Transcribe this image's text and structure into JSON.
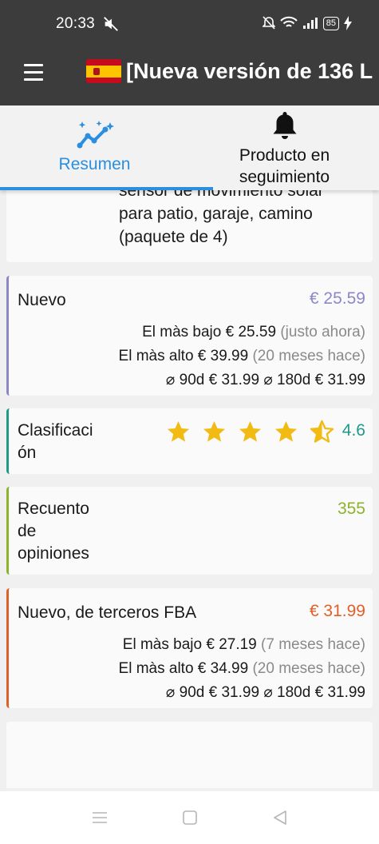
{
  "status_bar": {
    "time": "20:33",
    "battery": "85"
  },
  "app_bar": {
    "title": "[Nueva versión de 136 L",
    "flag": "spain-flag"
  },
  "tabs": [
    {
      "label": "Resumen",
      "icon": "sparkle-chart-icon",
      "active": true
    },
    {
      "label_line1": "Producto en",
      "label_line2": "seguimiento",
      "icon": "bell-icon",
      "active": false
    }
  ],
  "product": {
    "description_lines": [
      "sensor de movimiento solar",
      "para patio, garaje, camino",
      "(paquete de 4)"
    ]
  },
  "new_price": {
    "title": "Nuevo",
    "price": "€ 25.59",
    "lowest_label": "El màs bajo",
    "lowest_price": "€ 25.59",
    "lowest_when": "(justo ahora)",
    "highest_label": "El màs alto",
    "highest_price": "€ 39.99",
    "highest_when": "(20 meses hace)",
    "avg_90_label": "⌀ 90d",
    "avg_90": "€ 31.99",
    "avg_180_label": "⌀ 180d",
    "avg_180": "€ 31.99",
    "accent": "#8c88c8"
  },
  "rating": {
    "title_line1": "Clasificaci",
    "title_line2": "ón",
    "value": "4.6",
    "stars": 4.5,
    "accent": "#1f9a8a"
  },
  "reviews": {
    "title_lines": [
      "Recuento",
      "de",
      "opiniones"
    ],
    "value": "355",
    "accent": "#8cb32a"
  },
  "fba_price": {
    "title": "Nuevo, de terceros FBA",
    "price": "€ 31.99",
    "lowest_label": "El màs bajo",
    "lowest_price": "€ 27.19",
    "lowest_when": "(7 meses hace)",
    "highest_label": "El màs alto",
    "highest_price": "€ 34.99",
    "highest_when": "(20 meses hace)",
    "avg_90_label": "⌀ 90d",
    "avg_90": "€ 31.99",
    "avg_180_label": "⌀ 180d",
    "avg_180": "€ 31.99",
    "accent": "#e0602a"
  },
  "colors": {
    "tab_active": "#2a8fe0",
    "app_bar": "#3c3c3c",
    "star": "#f2bb13"
  }
}
